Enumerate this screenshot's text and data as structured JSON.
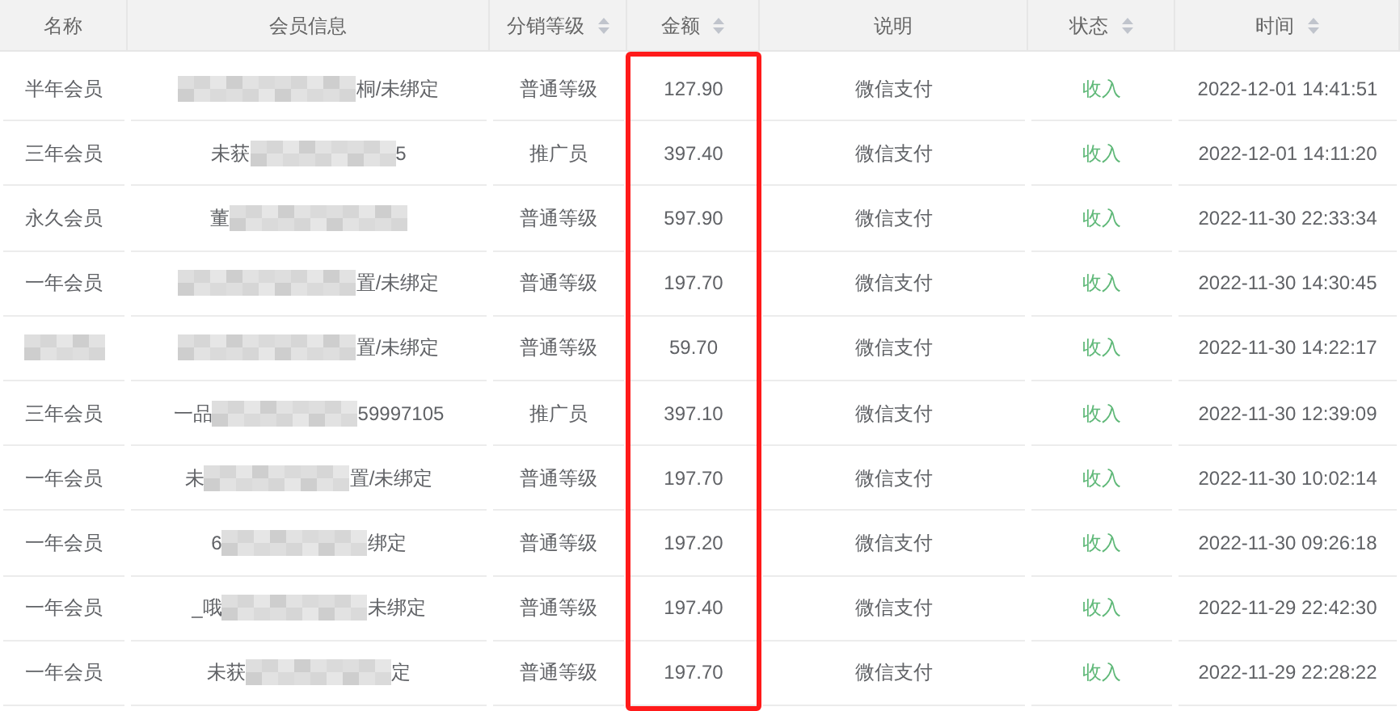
{
  "table": {
    "columns": [
      {
        "label": "名称",
        "sortable": false,
        "highlighted": false
      },
      {
        "label": "会员信息",
        "sortable": false,
        "highlighted": false
      },
      {
        "label": "分销等级",
        "sortable": true,
        "highlighted": false
      },
      {
        "label": "金额",
        "sortable": true,
        "highlighted": true
      },
      {
        "label": "说明",
        "sortable": false,
        "highlighted": false
      },
      {
        "label": "状态",
        "sortable": true,
        "highlighted": false
      },
      {
        "label": "时间",
        "sortable": true,
        "highlighted": false
      }
    ],
    "rows": [
      {
        "name": "半年会员",
        "info_prefix": "",
        "info_suffix": "桐/未绑定",
        "level": "普通等级",
        "amount": "127.90",
        "note": "微信支付",
        "status": "收入",
        "time": "2022-12-01 14:41:51"
      },
      {
        "name": "三年会员",
        "info_prefix": "未获",
        "info_suffix": "5",
        "level": "推广员",
        "amount": "397.40",
        "note": "微信支付",
        "status": "收入",
        "time": "2022-12-01 14:11:20"
      },
      {
        "name": "永久会员",
        "info_prefix": "董",
        "info_suffix": "",
        "level": "普通等级",
        "amount": "597.90",
        "note": "微信支付",
        "status": "收入",
        "time": "2022-11-30 22:33:34"
      },
      {
        "name": "一年会员",
        "info_prefix": "",
        "info_suffix": "置/未绑定",
        "level": "普通等级",
        "amount": "197.70",
        "note": "微信支付",
        "status": "收入",
        "time": "2022-11-30 14:30:45"
      },
      {
        "name": "",
        "info_prefix": "",
        "info_suffix": "置/未绑定",
        "level": "普通等级",
        "amount": "59.70",
        "note": "微信支付",
        "status": "收入",
        "time": "2022-11-30 14:22:17"
      },
      {
        "name": "三年会员",
        "info_prefix": "一品",
        "info_suffix": "59997105",
        "level": "推广员",
        "amount": "397.10",
        "note": "微信支付",
        "status": "收入",
        "time": "2022-11-30 12:39:09"
      },
      {
        "name": "一年会员",
        "info_prefix": "未",
        "info_suffix": "置/未绑定",
        "level": "普通等级",
        "amount": "197.70",
        "note": "微信支付",
        "status": "收入",
        "time": "2022-11-30 10:02:14"
      },
      {
        "name": "一年会员",
        "info_prefix": "6",
        "info_suffix": "绑定",
        "level": "普通等级",
        "amount": "197.20",
        "note": "微信支付",
        "status": "收入",
        "time": "2022-11-30 09:26:18"
      },
      {
        "name": "一年会员",
        "info_prefix": "_哦",
        "info_suffix": "未绑定",
        "level": "普通等级",
        "amount": "197.40",
        "note": "微信支付",
        "status": "收入",
        "time": "2022-11-29 22:42:30"
      },
      {
        "name": "一年会员",
        "info_prefix": "未获",
        "info_suffix": "定",
        "level": "普通等级",
        "amount": "197.70",
        "note": "微信支付",
        "status": "收入",
        "time": "2022-11-29 22:28:22"
      }
    ]
  }
}
